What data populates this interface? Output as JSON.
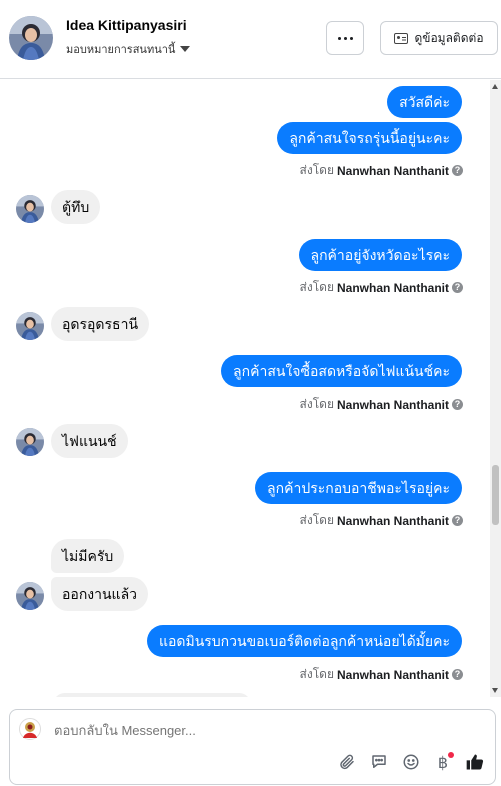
{
  "header": {
    "name": "Idea Kittipanyasiri",
    "assign_label": "มอบหมายการสนทนานี้",
    "more_label": "···",
    "contact_label": "ดูข้อมูลติดต่อ"
  },
  "messages": [
    {
      "text": "สวัสดีค่ะ"
    },
    {
      "text": "ลูกค้าสนใจรถรุ่นนี้อยู่นะคะ"
    },
    {
      "text": "ตู้ทึบ"
    },
    {
      "text": "ลูกค้าอยู่จังหวัดอะไรคะ"
    },
    {
      "text": "อุดรอุดรธานี"
    },
    {
      "text": "ลูกค้าสนใจซื้อสดหรือจัดไฟแน้นช์คะ"
    },
    {
      "text": "ไฟแนนช์"
    },
    {
      "text": "ลูกค้าประกอบอาชีพอะไรอยู่คะ"
    },
    {
      "text": "ไม่มีครับ"
    },
    {
      "text": "ออกงานแล้ว"
    },
    {
      "text": "แอดมินรบกวนขอเบอร์ติดต่อลูกค้าหน่อยได้มั้ยคะ"
    }
  ],
  "sent_by": {
    "prefix": "ส่งโดย",
    "name": "Nanwhan Nanthanit"
  },
  "composer": {
    "placeholder": "ตอบกลับใน Messenger..."
  },
  "icons": {
    "attach": "paperclip-icon",
    "saved_replies": "chat-bubbles-icon",
    "emoji": "smiley-icon",
    "payment": "baht-icon",
    "like": "thumbs-up-icon"
  },
  "colors": {
    "outgoing_bubble": "#0a7cff",
    "incoming_bubble": "#f0f0f0",
    "notification_dot": "#f02849"
  }
}
